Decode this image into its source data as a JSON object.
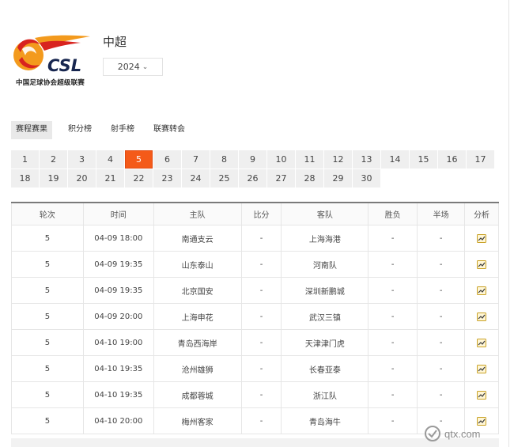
{
  "league": {
    "logo_text": "CSL",
    "logo_subtitle": "中国足球协会超级联赛",
    "title": "中超",
    "season": "2024",
    "brand_colors": {
      "orange": "#f39a1d",
      "red": "#d8231f",
      "navy": "#17264f"
    }
  },
  "tabs": [
    {
      "label": "赛程赛果",
      "active": true
    },
    {
      "label": "积分榜",
      "active": false
    },
    {
      "label": "射手榜",
      "active": false
    },
    {
      "label": "联赛转会",
      "active": false
    }
  ],
  "rounds": {
    "items": [
      "1",
      "2",
      "3",
      "4",
      "5",
      "6",
      "7",
      "8",
      "9",
      "10",
      "11",
      "12",
      "13",
      "14",
      "15",
      "16",
      "17",
      "18",
      "19",
      "20",
      "21",
      "22",
      "23",
      "24",
      "25",
      "26",
      "27",
      "28",
      "29",
      "30"
    ],
    "active": "5",
    "active_color": "#f45a19"
  },
  "table": {
    "headers": [
      "轮次",
      "时间",
      "主队",
      "比分",
      "客队",
      "胜负",
      "半场",
      "分析"
    ],
    "rows": [
      {
        "round": "5",
        "time": "04-09 18:00",
        "home": "南通支云",
        "score": "-",
        "away": "上海海港",
        "result": "-",
        "half": "-"
      },
      {
        "round": "5",
        "time": "04-09 19:35",
        "home": "山东泰山",
        "score": "-",
        "away": "河南队",
        "result": "-",
        "half": "-"
      },
      {
        "round": "5",
        "time": "04-09 19:35",
        "home": "北京国安",
        "score": "-",
        "away": "深圳新鹏城",
        "result": "-",
        "half": "-"
      },
      {
        "round": "5",
        "time": "04-09 20:00",
        "home": "上海申花",
        "score": "-",
        "away": "武汉三镇",
        "result": "-",
        "half": "-"
      },
      {
        "round": "5",
        "time": "04-10 19:00",
        "home": "青岛西海岸",
        "score": "-",
        "away": "天津津门虎",
        "result": "-",
        "half": "-"
      },
      {
        "round": "5",
        "time": "04-10 19:35",
        "home": "沧州雄狮",
        "score": "-",
        "away": "长春亚泰",
        "result": "-",
        "half": "-"
      },
      {
        "round": "5",
        "time": "04-10 19:35",
        "home": "成都蓉城",
        "score": "-",
        "away": "浙江队",
        "result": "-",
        "half": "-"
      },
      {
        "round": "5",
        "time": "04-10 20:00",
        "home": "梅州客家",
        "score": "-",
        "away": "青岛海牛",
        "result": "-",
        "half": "-"
      }
    ],
    "analysis_icon": "chart-analysis-icon"
  },
  "watermark": {
    "text": "qtx.com",
    "icon": "qtx-logo-icon"
  }
}
